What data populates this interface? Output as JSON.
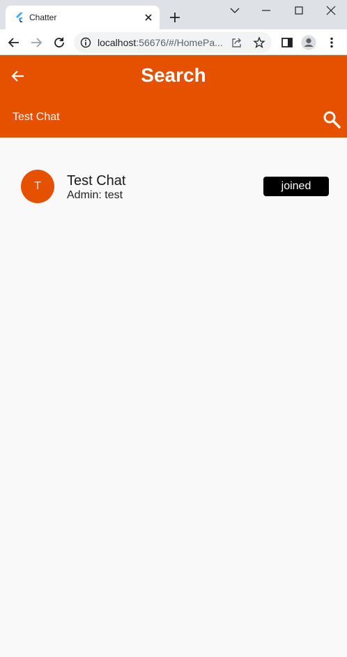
{
  "browser": {
    "tab_title": "Chatter",
    "url_host": "localhost",
    "url_rest": ":56676/#/HomePa..."
  },
  "app": {
    "title": "Search",
    "search_value": "Test Chat",
    "accent": "#e65100",
    "results": [
      {
        "initial": "T",
        "name": "Test Chat",
        "admin": "Admin: test",
        "status_label": "joined"
      }
    ]
  },
  "icons": {
    "tab": [
      "flutter-icon",
      "close-icon",
      "new-tab-icon"
    ],
    "window": [
      "chevron-down-icon",
      "minimize-icon",
      "maximize-icon",
      "close-window-icon"
    ],
    "toolbar": [
      "back-icon",
      "forward-icon",
      "reload-icon",
      "info-icon",
      "share-icon",
      "star-icon",
      "side-panel-icon",
      "profile-icon",
      "menu-icon"
    ],
    "app": [
      "arrow-back-icon",
      "search-icon"
    ]
  }
}
